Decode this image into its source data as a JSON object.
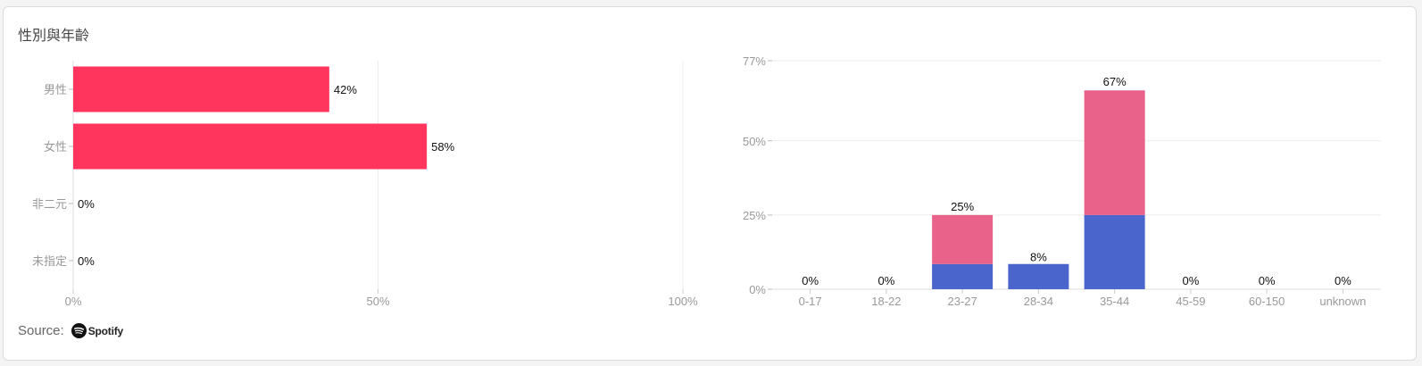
{
  "card": {
    "title": "性別與年齡"
  },
  "source": {
    "label": "Source:",
    "brand": "Spotify"
  },
  "colors": {
    "gender_bar": "#ff355e",
    "age_bar_top": "#e8628a",
    "age_bar_bottom": "#4a66cc",
    "grid": "#ececec",
    "tick_text": "#999999",
    "value_text": "#111111"
  },
  "chart_data": [
    {
      "type": "bar",
      "orientation": "horizontal",
      "categories": [
        "男性",
        "女性",
        "非二元",
        "未指定"
      ],
      "values": [
        42,
        58,
        0,
        0
      ],
      "value_labels": [
        "42%",
        "58%",
        "0%",
        "0%"
      ],
      "xlim": [
        0,
        100
      ],
      "xticks": [
        0,
        50,
        100
      ],
      "xtick_labels": [
        "0%",
        "50%",
        "100%"
      ],
      "grid": true
    },
    {
      "type": "bar",
      "stacked": true,
      "categories": [
        "0-17",
        "18-22",
        "23-27",
        "28-34",
        "35-44",
        "45-59",
        "60-150",
        "unknown"
      ],
      "series": [
        {
          "values": [
            0,
            0,
            8.5,
            8.5,
            25,
            0,
            0,
            0
          ]
        },
        {
          "values": [
            0,
            0,
            16.5,
            0,
            42,
            0,
            0,
            0
          ]
        }
      ],
      "totals": [
        0,
        0,
        25,
        8,
        67,
        0,
        0,
        0
      ],
      "total_labels": [
        "0%",
        "0%",
        "25%",
        "8%",
        "67%",
        "0%",
        "0%",
        "0%"
      ],
      "ylim": [
        0,
        77
      ],
      "yticks": [
        0,
        25,
        50,
        77
      ],
      "ytick_labels": [
        "0%",
        "25%",
        "50%",
        "77%"
      ],
      "grid": true
    }
  ]
}
